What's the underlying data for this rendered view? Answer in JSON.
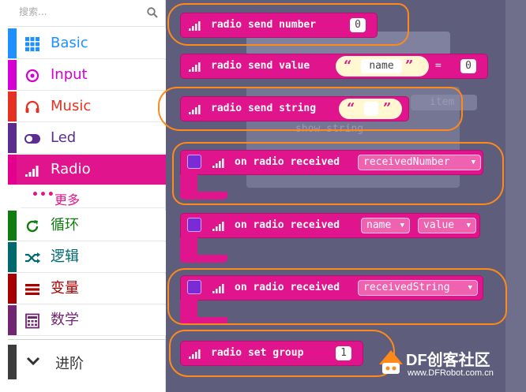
{
  "search": {
    "placeholder": "搜索..."
  },
  "categories": [
    {
      "label": "Basic",
      "color": "#1e90ff",
      "icon": "grid-icon"
    },
    {
      "label": "Input",
      "color": "#d400d4",
      "icon": "target-icon"
    },
    {
      "label": "Music",
      "color": "#e63022",
      "icon": "headphones-icon"
    },
    {
      "label": "Led",
      "color": "#5c2d91",
      "icon": "toggle-icon"
    },
    {
      "label": "Radio",
      "color": "#e3008c",
      "icon": "signal-icon"
    },
    {
      "label": "循环",
      "color": "#107c10",
      "icon": "refresh-icon"
    },
    {
      "label": "逻辑",
      "color": "#006970",
      "icon": "shuffle-icon"
    },
    {
      "label": "变量",
      "color": "#a80000",
      "icon": "list-icon"
    },
    {
      "label": "数学",
      "color": "#712672",
      "icon": "calculator-icon"
    }
  ],
  "subcategory": {
    "label": "更多",
    "icon": "more-dots-icon"
  },
  "advanced": {
    "label": "进阶",
    "icon": "chevron-down-icon"
  },
  "blocks": {
    "send_number": {
      "label": "radio send number",
      "value": "0"
    },
    "send_value": {
      "label": "radio send value",
      "name": "name",
      "equals": "=",
      "value": "0"
    },
    "send_string": {
      "label": "radio send string"
    },
    "received_number": {
      "label": "on radio received",
      "var": "receivedNumber"
    },
    "received_name_value": {
      "label": "on radio received",
      "var1": "name",
      "var2": "value"
    },
    "received_string": {
      "label": "on radio received",
      "var": "receivedString"
    },
    "set_group": {
      "label": "radio set group",
      "value": "1"
    }
  },
  "ghost": {
    "show_string": "show string",
    "item": "item"
  },
  "watermark": {
    "brand": "DF创客社区",
    "url": "www.DFRobot.com.cn"
  },
  "colors": {
    "radio": "#e0148c",
    "highlight": "#ff8a1a",
    "flyout": "#5e5e7c"
  }
}
